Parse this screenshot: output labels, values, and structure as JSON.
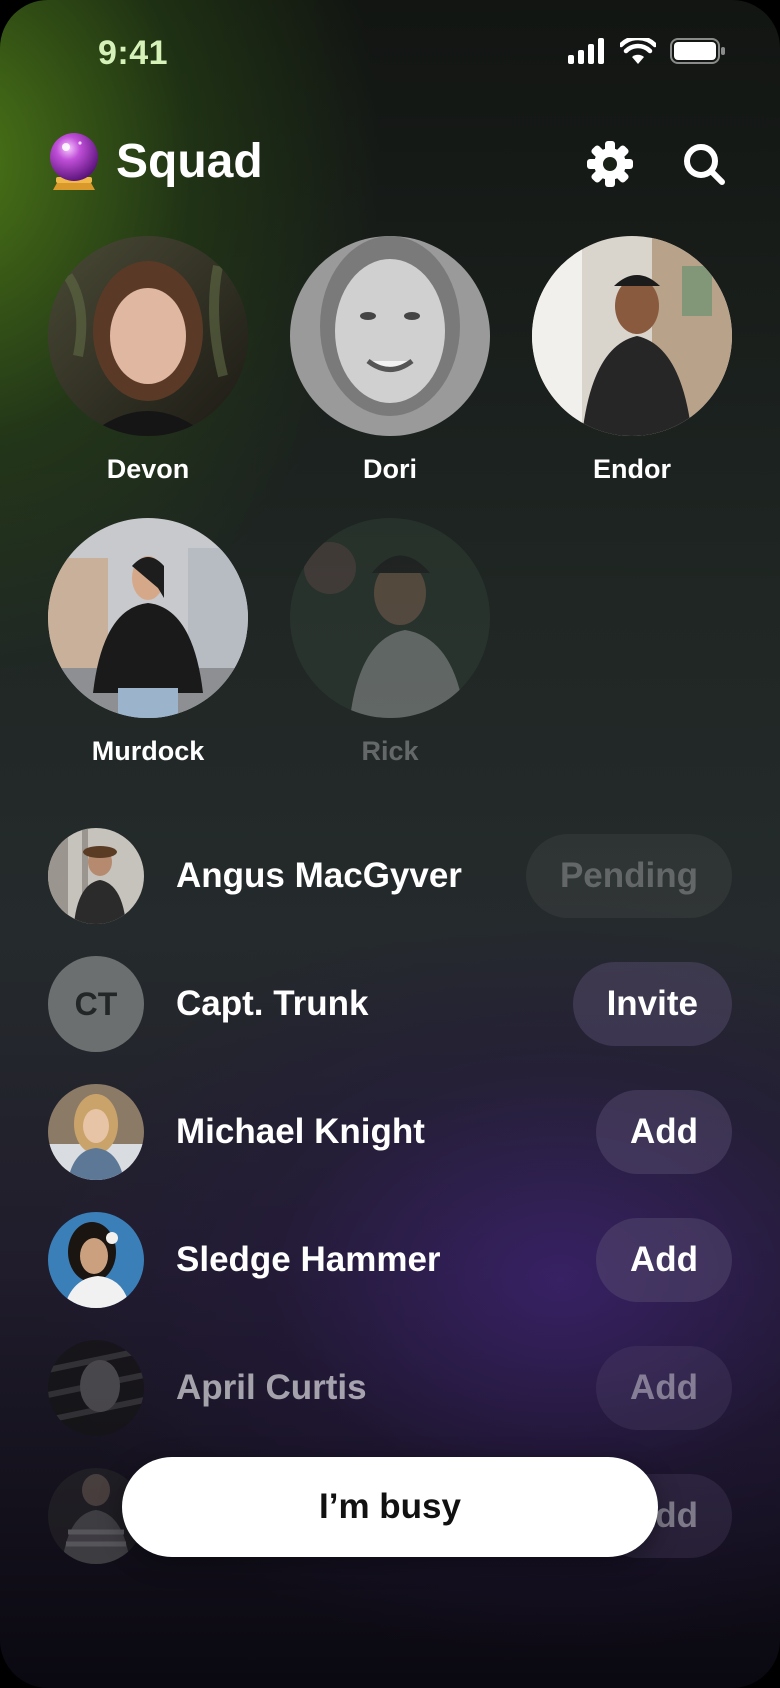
{
  "status": {
    "time": "9:41"
  },
  "header": {
    "title": "Squad",
    "app_icon": "crystal-ball-icon",
    "settings_icon": "gear-icon",
    "search_icon": "search-icon"
  },
  "favorites": [
    {
      "name": "Devon",
      "dimmed": false
    },
    {
      "name": "Dori",
      "dimmed": false
    },
    {
      "name": "Endor",
      "dimmed": false
    },
    {
      "name": "Murdock",
      "dimmed": false
    },
    {
      "name": "Rick",
      "dimmed": true
    }
  ],
  "contacts": [
    {
      "name": "Angus MacGyver",
      "action": "Pending"
    },
    {
      "name": "Capt. Trunk",
      "initials": "CT",
      "action": "Invite"
    },
    {
      "name": "Michael Knight",
      "action": "Add"
    },
    {
      "name": "Sledge Hammer",
      "action": "Add"
    },
    {
      "name": "April Curtis",
      "action": "Add"
    },
    {
      "name": "",
      "action": "Add"
    }
  ],
  "busy_button": {
    "label": "I’m busy"
  },
  "colors": {
    "accent_green": "#4e7c16",
    "accent_purple": "#3c226e",
    "pill": "#4a4260"
  }
}
